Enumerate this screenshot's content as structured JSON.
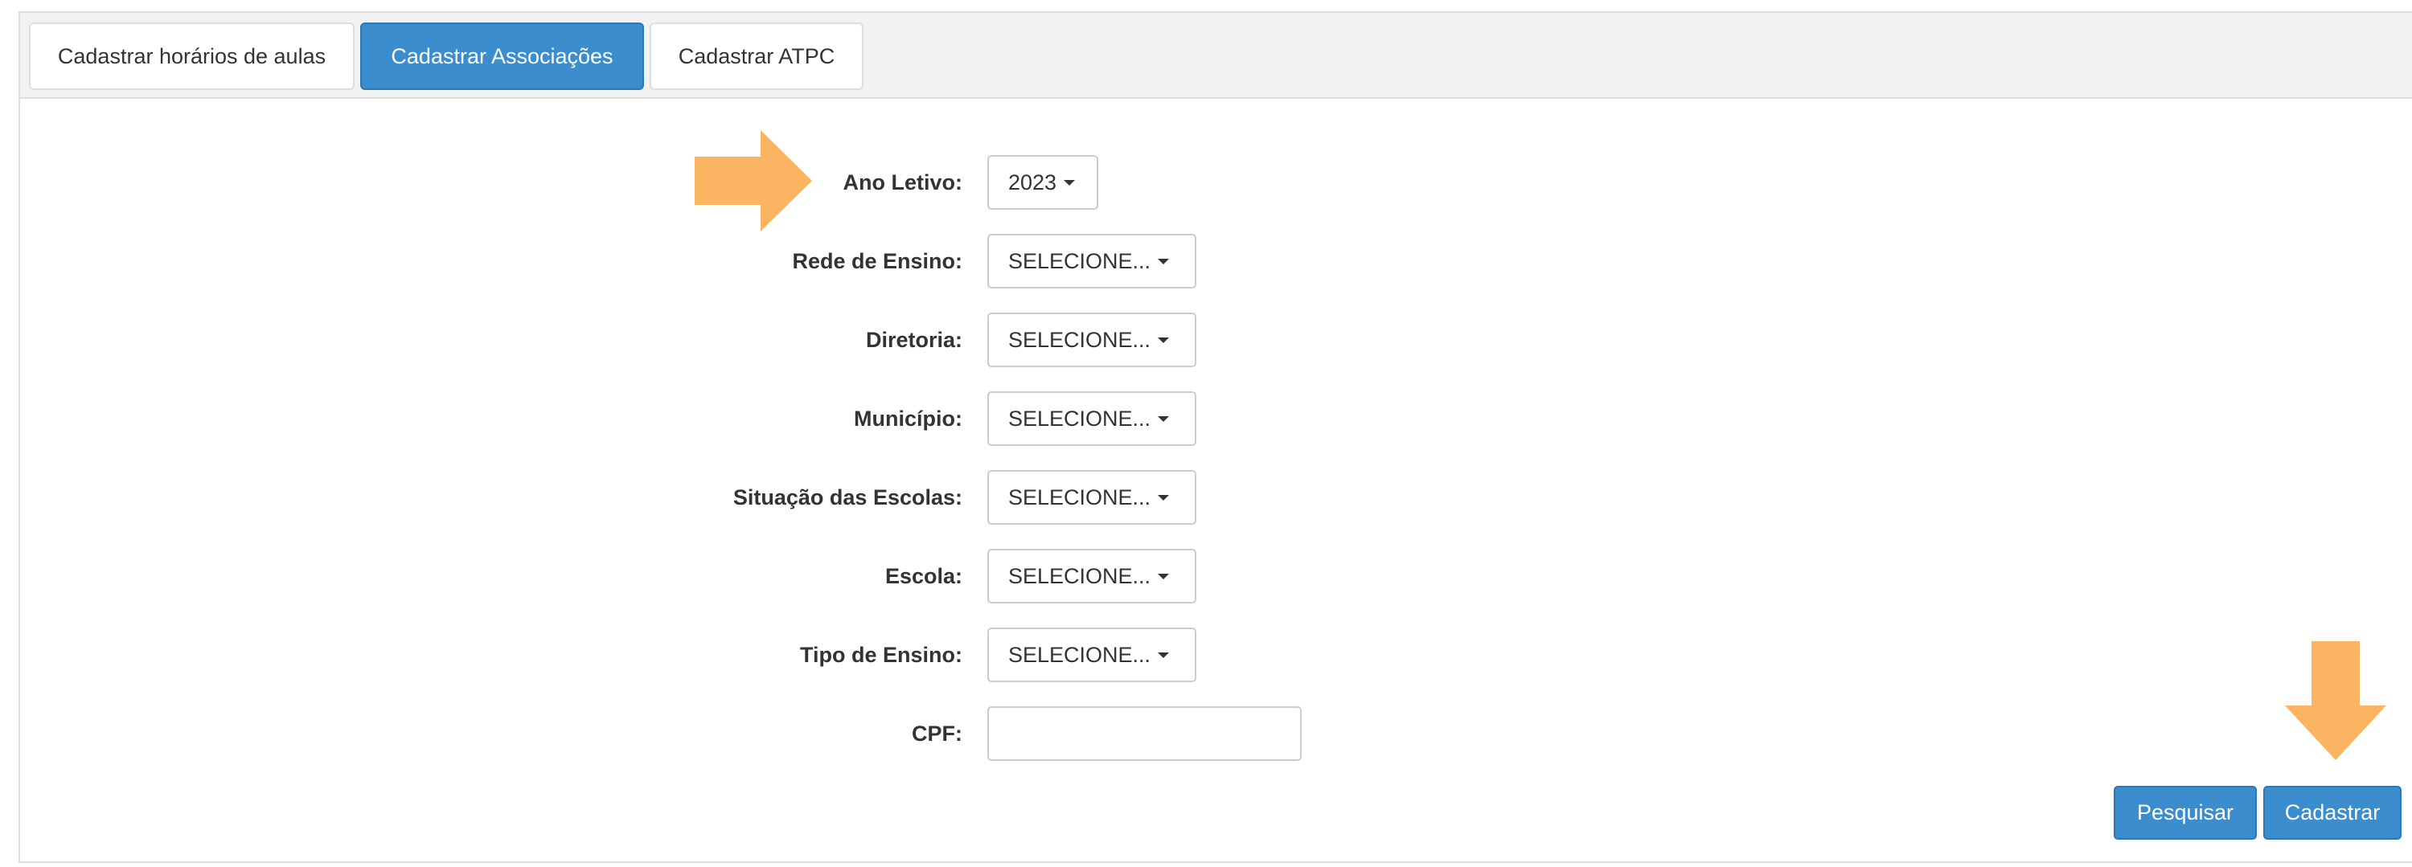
{
  "tabs": [
    {
      "label": "Cadastrar horários de aulas",
      "active": false
    },
    {
      "label": "Cadastrar Associações",
      "active": true
    },
    {
      "label": "Cadastrar ATPC",
      "active": false
    }
  ],
  "form": {
    "ano_letivo": {
      "label": "Ano Letivo:",
      "value": "2023"
    },
    "rede_ensino": {
      "label": "Rede de Ensino:",
      "value": "SELECIONE..."
    },
    "diretoria": {
      "label": "Diretoria:",
      "value": "SELECIONE..."
    },
    "municipio": {
      "label": "Município:",
      "value": "SELECIONE..."
    },
    "situacao_escolas": {
      "label": "Situação das Escolas:",
      "value": "SELECIONE..."
    },
    "escola": {
      "label": "Escola:",
      "value": "SELECIONE..."
    },
    "tipo_ensino": {
      "label": "Tipo de Ensino:",
      "value": "SELECIONE..."
    },
    "cpf": {
      "label": "CPF:",
      "value": ""
    }
  },
  "actions": {
    "search_label": "Pesquisar",
    "save_label": "Cadastrar"
  },
  "annotations": {
    "arrow_color": "#fbb562",
    "arrows": [
      "arrow-right-icon",
      "arrow-down-icon"
    ]
  },
  "colors": {
    "primary": "#3c8dce",
    "primary_border": "#2f77b2",
    "tabbar_bg": "#f2f2f2",
    "border": "#dddddd"
  }
}
